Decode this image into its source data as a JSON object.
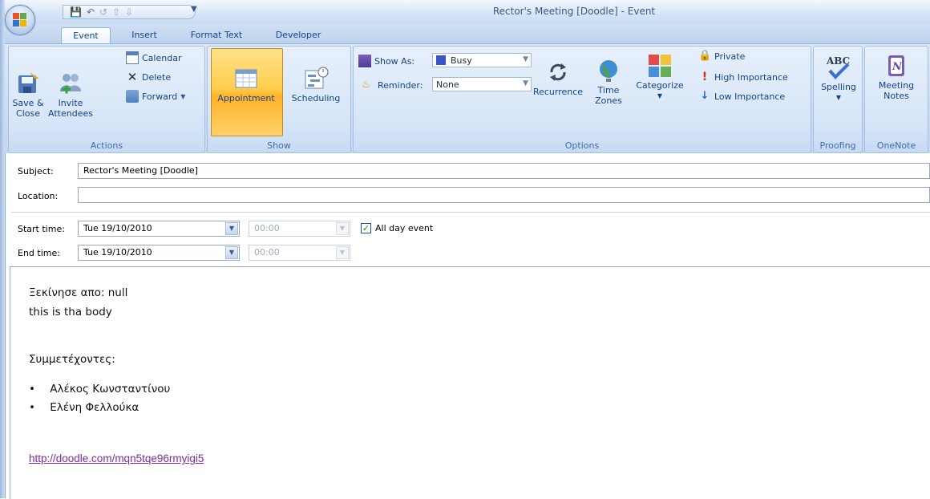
{
  "window": {
    "title": "Rector's Meeting [Doodle] - Event"
  },
  "tabs": [
    {
      "label": "Event",
      "active": true
    },
    {
      "label": "Insert"
    },
    {
      "label": "Format Text"
    },
    {
      "label": "Developer"
    }
  ],
  "ribbon": {
    "actions": {
      "group_label": "Actions",
      "save_close": {
        "line1": "Save &",
        "line2": "Close"
      },
      "invite": {
        "line1": "Invite",
        "line2": "Attendees"
      },
      "calendar": "Calendar",
      "delete": "Delete",
      "forward": "Forward"
    },
    "show": {
      "group_label": "Show",
      "appointment": "Appointment",
      "scheduling": "Scheduling"
    },
    "options": {
      "group_label": "Options",
      "show_as_label": "Show As:",
      "show_as_value": "Busy",
      "reminder_label": "Reminder:",
      "reminder_value": "None",
      "recurrence": "Recurrence",
      "time_zones": {
        "line1": "Time",
        "line2": "Zones"
      },
      "categorize": "Categorize",
      "private": "Private",
      "high_importance": "High Importance",
      "low_importance": "Low Importance"
    },
    "proofing": {
      "group_label": "Proofing",
      "spelling": "Spelling"
    },
    "onenote": {
      "group_label": "OneNote",
      "meeting_notes": {
        "line1": "Meeting",
        "line2": "Notes"
      }
    }
  },
  "form": {
    "subject_label": "Subject:",
    "subject_value": "Rector's Meeting [Doodle]",
    "location_label": "Location:",
    "location_value": "",
    "start_label": "Start time:",
    "start_date": "Tue 19/10/2010",
    "start_time": "00:00",
    "end_label": "End time:",
    "end_date": "Tue 19/10/2010",
    "end_time": "00:00",
    "all_day_label": "All day event",
    "all_day_checked": true
  },
  "body": {
    "line1": "Ξεκίνησε απο: null",
    "line2": "this is tha body",
    "participants_heading": "Συμμετέχοντες:",
    "participants": [
      "Αλέκος Κωνσταντίνου",
      "Ελένη Φελλούκα"
    ],
    "link": "http://doodle.com/mqn5tqe96rmyigi5"
  },
  "colors": {
    "accent": "#15428b",
    "link": "#7b2c98",
    "ribbon_bg": "#c8daf2",
    "active_button": "#ffd04e"
  }
}
